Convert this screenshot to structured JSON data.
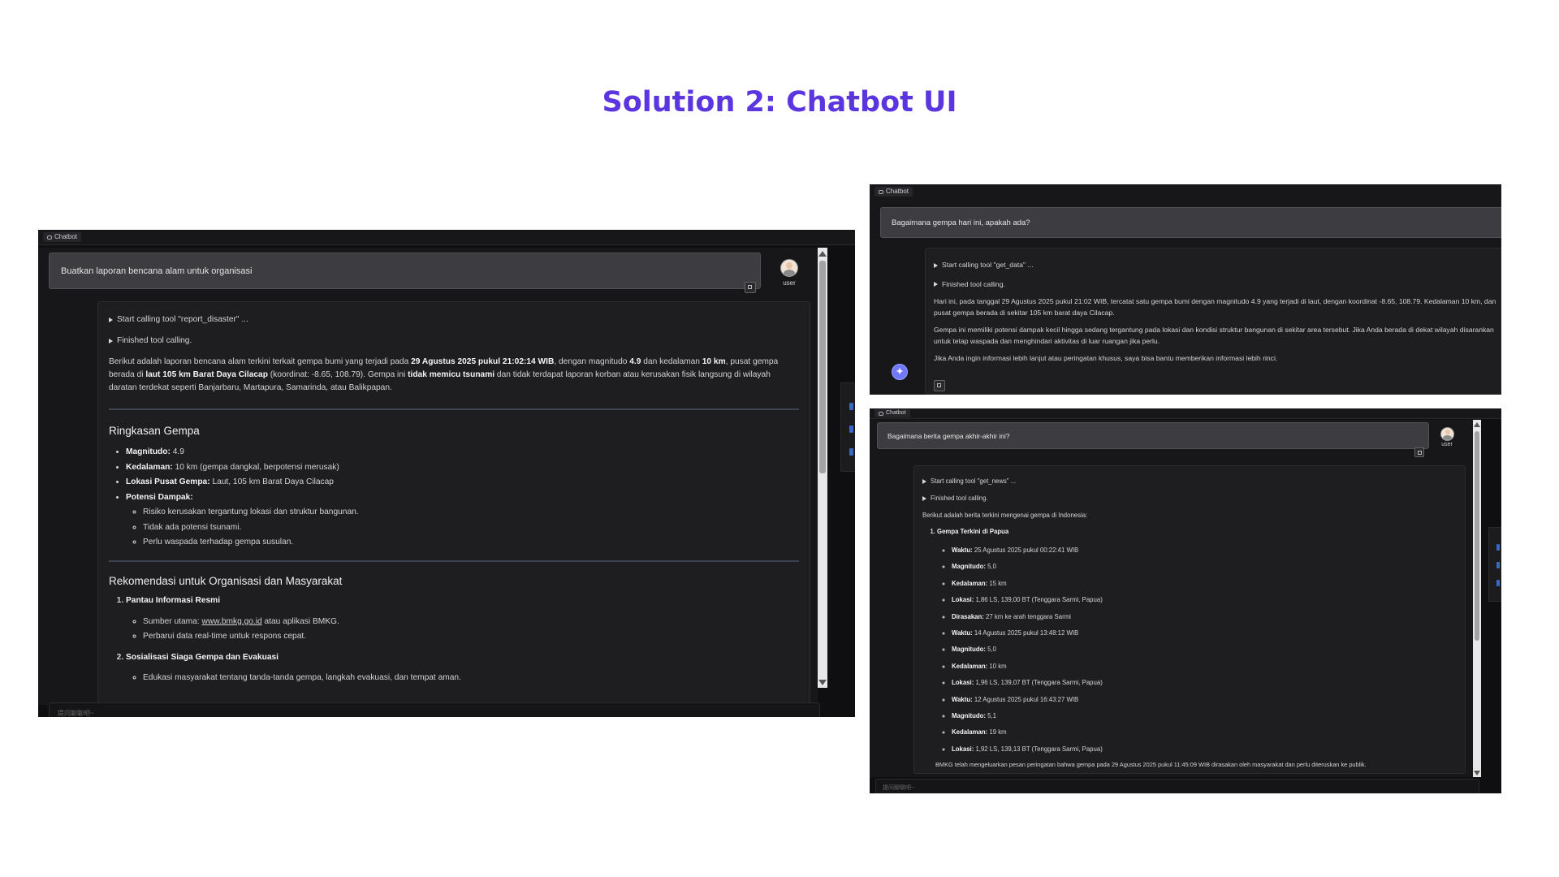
{
  "slide": {
    "title": "Solution 2: Chatbot UI"
  },
  "panel_left": {
    "tab_label": "Chatbot",
    "user_message": "Buatkan laporan bencana alam untuk organisasi",
    "user_label": "user",
    "tool_start": "Start calling tool \"report_disaster\" ...",
    "tool_done": "Finished tool calling.",
    "intro": {
      "t1": "Berikut adalah laporan bencana alam terkini terkait gempa bumi yang terjadi pada ",
      "b1": "29 Agustus 2025 pukul 21:02:14 WIB",
      "t2": ", dengan magnitudo ",
      "b2": "4.9",
      "t3": " dan kedalaman ",
      "b3": "10 km",
      "t4": ", pusat gempa berada di ",
      "b4": "laut 105 km Barat Daya Cilacap",
      "t5": " (koordinat: -8.65, 108.79). Gempa ini ",
      "b5": "tidak memicu tsunami",
      "t6": " dan tidak terdapat laporan korban atau kerusakan fisik langsung di wilayah daratan terdekat seperti Banjarbaru, Martapura, Samarinda, atau Balikpapan."
    },
    "summary_heading": "Ringkasan Gempa",
    "summary": [
      {
        "label": "Magnitudo:",
        "value": " 4.9"
      },
      {
        "label": "Kedalaman:",
        "value": " 10 km (gempa dangkal, berpotensi merusak)"
      },
      {
        "label": "Lokasi Pusat Gempa:",
        "value": " Laut, 105 km Barat Daya Cilacap"
      },
      {
        "label": "Potensi Dampak:",
        "value": ""
      }
    ],
    "impacts": [
      "Risiko kerusakan tergantung lokasi dan struktur bangunan.",
      "Tidak ada potensi tsunami.",
      "Perlu waspada terhadap gempa susulan."
    ],
    "rec_heading": "Rekomendasi untuk Organisasi dan Masyarakat",
    "rec1_title": "Pantau Informasi Resmi",
    "rec1_items": {
      "i1_prefix": "Sumber utama: ",
      "i1_link": "www.bmkg.go.id",
      "i1_suffix": " atau aplikasi BMKG.",
      "i2": "Perbarui data real-time untuk respons cepat."
    },
    "rec2_title": "Sosialisasi Siaga Gempa dan Evakuasi",
    "rec2_items": [
      "Edukasi masyarakat tentang tanda-tanda gempa, langkah evakuasi, dan tempat aman."
    ],
    "input_placeholder": "提问聊聊吧~"
  },
  "panel_tr": {
    "tab_label": "Chatbot",
    "user_message": "Bagaimana gempa hari ini, apakah ada?",
    "tool_start": "Start calling tool \"get_data\" ...",
    "tool_done": "Finished tool calling.",
    "p1": "Hari ini, pada tanggal 29 Agustus 2025 pukul 21:02 WIB, tercatat satu gempa bumi dengan magnitudo 4.9 yang terjadi di laut, dengan koordinat -8.65, 108.79. Kedalaman 10 km, dan pusat gempa berada di sekitar 105 km barat daya Cilacap.",
    "p2": "Gempa ini memiliki potensi dampak kecil hingga sedang tergantung pada lokasi dan kondisi struktur bangunan di sekitar area tersebut. Jika Anda berada di dekat wilayah disarankan untuk tetap waspada dan menghindari aktivitas di luar ruangan jika perlu.",
    "p3": "Jika Anda ingin informasi lebih lanjut atau peringatan khusus, saya bisa bantu memberikan informasi lebih rinci."
  },
  "panel_br": {
    "tab_label": "Chatbot",
    "user_message": "Bagaimana berita gempa akhir-akhir ini?",
    "user_label": "user",
    "tool_start": "Start calling tool \"get_news\" ...",
    "tool_done": "Finished tool calling.",
    "intro": "Berikut adalah berita terkini mengenai gempa di Indonesia:",
    "section_title": "Gempa Terkini di Papua",
    "items": [
      {
        "label": "Waktu:",
        "value": " 25 Agustus 2025 pukul 00:22:41 WIB"
      },
      {
        "label": "Magnitudo:",
        "value": " 5,0"
      },
      {
        "label": "Kedalaman:",
        "value": " 15 km"
      },
      {
        "label": "Lokasi:",
        "value": " 1,86 LS, 139,00 BT (Tenggara Sarmi, Papua)"
      },
      {
        "label": "Dirasakan:",
        "value": " 27 km ke arah tenggara Sarmi"
      },
      {
        "label": "Waktu:",
        "value": " 14 Agustus 2025 pukul 13:48:12 WIB"
      },
      {
        "label": "Magnitudo:",
        "value": " 5,0"
      },
      {
        "label": "Kedalaman:",
        "value": " 10 km"
      },
      {
        "label": "Lokasi:",
        "value": " 1,96 LS, 139,07 BT (Tenggara Sarmi, Papua)"
      },
      {
        "label": "Waktu:",
        "value": " 12 Agustus 2025 pukul 16:43:27 WIB"
      },
      {
        "label": "Magnitudo:",
        "value": " 5,1"
      },
      {
        "label": "Kedalaman:",
        "value": " 19 km"
      },
      {
        "label": "Lokasi:",
        "value": " 1,92 LS, 139,13 BT (Tenggara Sarmi, Papua)"
      }
    ],
    "footer_text": "BMKG telah mengeluarkan pesan peringatan bahwa gempa pada 29 Agustus 2025 pukul 11:45:09 WIB dirasakan oleh masyarakat dan perlu diteruskan ke publik.",
    "input_placeholder": "提问聊聊吧~"
  },
  "icons": {
    "copy": "copy-icon",
    "user_avatar": "user-avatar",
    "bot_avatar": "bot-avatar-icon",
    "disclosure": "triangle-right-icon"
  },
  "colors": {
    "title": "#5b36e0",
    "panel_bg": "#0f0f11",
    "chat_bg": "#17171a",
    "user_bubble": "#3d3d41",
    "bot_bubble": "#1e1e21"
  }
}
